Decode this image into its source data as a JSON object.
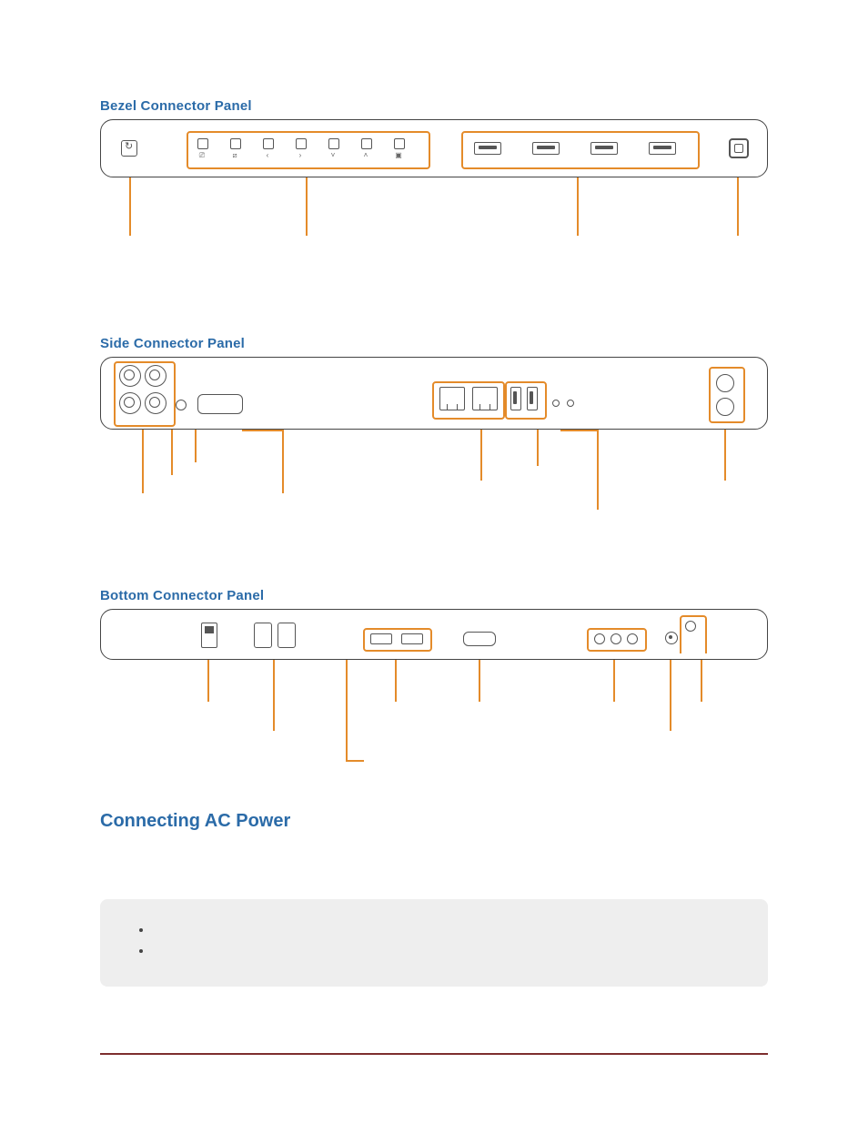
{
  "sections": {
    "bezel": {
      "title": "Bezel Connector Panel"
    },
    "side": {
      "title": "Side Connector Panel"
    },
    "bottom": {
      "title": "Bottom Connector Panel"
    },
    "power": {
      "title": "Connecting AC Power"
    }
  },
  "power_body_1": "",
  "power_body_2": "",
  "notes": {
    "items": [
      "",
      ""
    ]
  },
  "colors": {
    "heading": "#2b6ba8",
    "highlight": "#e48b2a",
    "rule": "#7d2e2e"
  }
}
